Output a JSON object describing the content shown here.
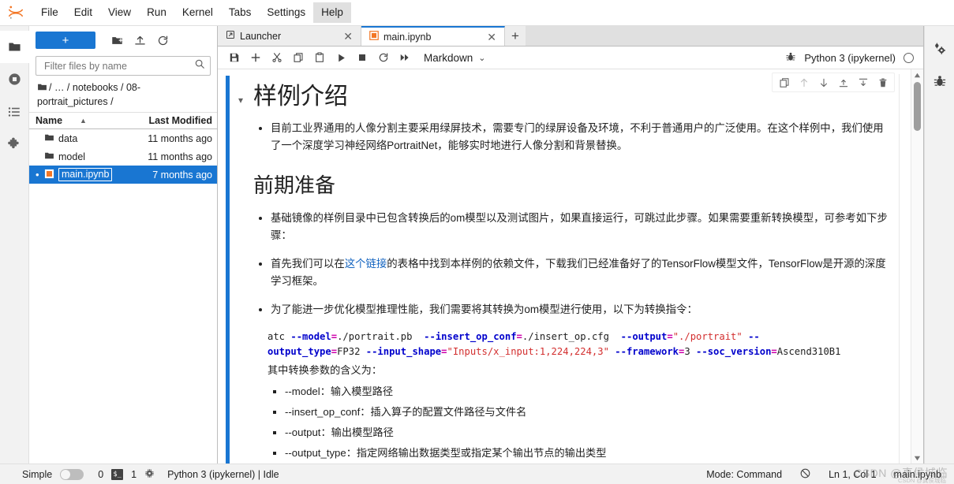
{
  "menubar": {
    "logo_icon": "jupyter-logo",
    "items": [
      {
        "label": "File"
      },
      {
        "label": "Edit"
      },
      {
        "label": "View"
      },
      {
        "label": "Run"
      },
      {
        "label": "Kernel"
      },
      {
        "label": "Tabs"
      },
      {
        "label": "Settings"
      },
      {
        "label": "Help"
      }
    ],
    "active_item": "Help"
  },
  "left_activity_bar": {
    "items": [
      {
        "icon": "folder-icon",
        "title": "File Browser"
      },
      {
        "icon": "running-terminals-icon",
        "title": "Running Terminals and Kernels"
      },
      {
        "icon": "commands-list-icon",
        "title": "Commands"
      },
      {
        "icon": "extension-puzzle-icon",
        "title": "Extension Manager"
      }
    ]
  },
  "right_activity_bar": {
    "items": [
      {
        "icon": "property-inspector-gears-icon",
        "title": "Property Inspector"
      },
      {
        "icon": "debugger-bug-icon",
        "title": "Debugger"
      }
    ]
  },
  "file_browser": {
    "new_button_label": "+",
    "toolbar_icons": [
      {
        "icon": "new-folder-icon"
      },
      {
        "icon": "upload-icon"
      },
      {
        "icon": "refresh-icon"
      }
    ],
    "filter": {
      "placeholder": "Filter files by name",
      "value": "",
      "icon": "search-icon"
    },
    "breadcrumb": {
      "root_icon": "folder-icon",
      "parts": [
        "/",
        "…",
        "/",
        "notebooks",
        "/",
        "08-portrait_pictures",
        "/"
      ],
      "text": "/ … / notebooks / 08-portrait_pictures /"
    },
    "columns": {
      "name": "Name",
      "last_modified": "Last Modified",
      "sort_indicator": "▲"
    },
    "rows": [
      {
        "icon": "folder-icon",
        "name": "data",
        "modified": "11 months ago",
        "selected": false
      },
      {
        "icon": "folder-icon",
        "name": "model",
        "modified": "11 months ago",
        "selected": false
      },
      {
        "icon": "notebook-icon",
        "name": "main.ipynb",
        "modified": "7 months ago",
        "selected": true
      }
    ]
  },
  "tabbar": {
    "tabs": [
      {
        "label": "Launcher",
        "icon": "launcher-icon",
        "active": false,
        "close": "✕"
      },
      {
        "label": "main.ipynb",
        "icon": "notebook-icon",
        "active": true,
        "close": "✕"
      }
    ],
    "add_tab_label": "+"
  },
  "notebook_toolbar": {
    "buttons": [
      {
        "icon": "save-icon",
        "title": "Save"
      },
      {
        "icon": "add-cell-icon",
        "title": "Insert a cell below"
      },
      {
        "icon": "cut-icon",
        "title": "Cut"
      },
      {
        "icon": "copy-icon",
        "title": "Copy"
      },
      {
        "icon": "paste-icon",
        "title": "Paste"
      },
      {
        "icon": "run-icon",
        "title": "Run"
      },
      {
        "icon": "stop-icon",
        "title": "Interrupt the kernel"
      },
      {
        "icon": "restart-icon",
        "title": "Restart the kernel"
      },
      {
        "icon": "restart-run-all-icon",
        "title": "Restart and run all"
      }
    ],
    "cell_type": "Markdown",
    "cell_type_caret": "⌄",
    "kernel_debug_icon": "debugger-bug-icon",
    "kernel_name": "Python 3 (ipykernel)",
    "kernel_status_icon": "idle-circle-icon"
  },
  "cell_toolbar": {
    "buttons": [
      {
        "icon": "duplicate-cell-icon",
        "disabled": false
      },
      {
        "icon": "move-cell-up-icon",
        "disabled": true
      },
      {
        "icon": "move-cell-down-icon",
        "disabled": false
      },
      {
        "icon": "insert-cell-above-icon",
        "disabled": false
      },
      {
        "icon": "insert-cell-below-icon",
        "disabled": false
      },
      {
        "icon": "delete-cell-icon",
        "disabled": false
      }
    ]
  },
  "notebook": {
    "collapse_caret": "▾",
    "heading1": "样例介绍",
    "bullet1": "目前工业界通用的人像分割主要采用绿屏技术，需要专门的绿屏设备及环境，不利于普通用户的广泛使用。在这个样例中，我们使用了一个深度学习神经网络PortraitNet，能够实时地进行人像分割和背景替换。",
    "heading2": "前期准备",
    "bullet2": "基础镜像的样例目录中已包含转换后的om模型以及测试图片，如果直接运行，可跳过此步骤。如果需要重新转换模型，可参考如下步骤：",
    "bullet3": {
      "before_link": "首先我们可以在",
      "link_text": "这个链接",
      "after_link": "的表格中找到本样例的依赖文件，下载我们已经准备好了的TensorFlow模型文件，TensorFlow是开源的深度学习框架。"
    },
    "bullet4": "为了能进一步优化模型推理性能，我们需要将其转换为om模型进行使用，以下为转换指令：",
    "code": {
      "line1": [
        {
          "t": "atc ",
          "c": "plain"
        },
        {
          "t": "--model",
          "c": "flag"
        },
        {
          "t": "=",
          "c": "eq"
        },
        {
          "t": "./portrait.pb  ",
          "c": "plain"
        },
        {
          "t": "--insert_op_conf",
          "c": "flag"
        },
        {
          "t": "=",
          "c": "eq"
        },
        {
          "t": "./insert_op.cfg  ",
          "c": "plain"
        },
        {
          "t": "--output",
          "c": "flag"
        },
        {
          "t": "=",
          "c": "eq"
        },
        {
          "t": "\"./portrait\"",
          "c": "str"
        },
        {
          "t": " --",
          "c": "flag"
        }
      ],
      "line2": [
        {
          "t": "output_type",
          "c": "flag"
        },
        {
          "t": "=",
          "c": "eq"
        },
        {
          "t": "FP32 ",
          "c": "plain"
        },
        {
          "t": "--input_shape",
          "c": "flag"
        },
        {
          "t": "=",
          "c": "eq"
        },
        {
          "t": "\"Inputs/x_input:1,224,224,3\"",
          "c": "str"
        },
        {
          "t": " ",
          "c": "plain"
        },
        {
          "t": "--framework",
          "c": "flag"
        },
        {
          "t": "=",
          "c": "eq"
        },
        {
          "t": "3 ",
          "c": "plain"
        },
        {
          "t": "--soc_version",
          "c": "flag"
        },
        {
          "t": "=",
          "c": "eq"
        },
        {
          "t": "Ascend310B1",
          "c": "plain"
        }
      ]
    },
    "code_caption": "其中转换参数的含义为：",
    "subbullets": [
      "--model：输入模型路径",
      "--insert_op_conf：插入算子的配置文件路径与文件名",
      "--output：输出模型路径",
      "--output_type：指定网络输出数据类型或指定某个输出节点的输出类型"
    ]
  },
  "statusbar": {
    "simple_label": "Simple",
    "simple_enabled": false,
    "terminals_count": "0",
    "terminal_icon": "terminal-icon",
    "kernels_count": "1",
    "kernel_icon": "kernel-chip-icon",
    "kernel_status": "Python 3 (ipykernel) | Idle",
    "mode": "Mode: Command",
    "no_connection_icon": "no-connection-icon",
    "cursor_position": "Ln 1, Col 1",
    "notebook_name": "main.ipynb",
    "watermark": "CSDN @真侯城临",
    "watermark_small": "CSDN @真侯城临"
  },
  "colors": {
    "accent": "#1976d2",
    "selection": "#1976d2",
    "link": "#1565c0",
    "code_flag": "#0000cc",
    "code_eq": "#cc00aa",
    "code_string": "#d32f2f"
  }
}
